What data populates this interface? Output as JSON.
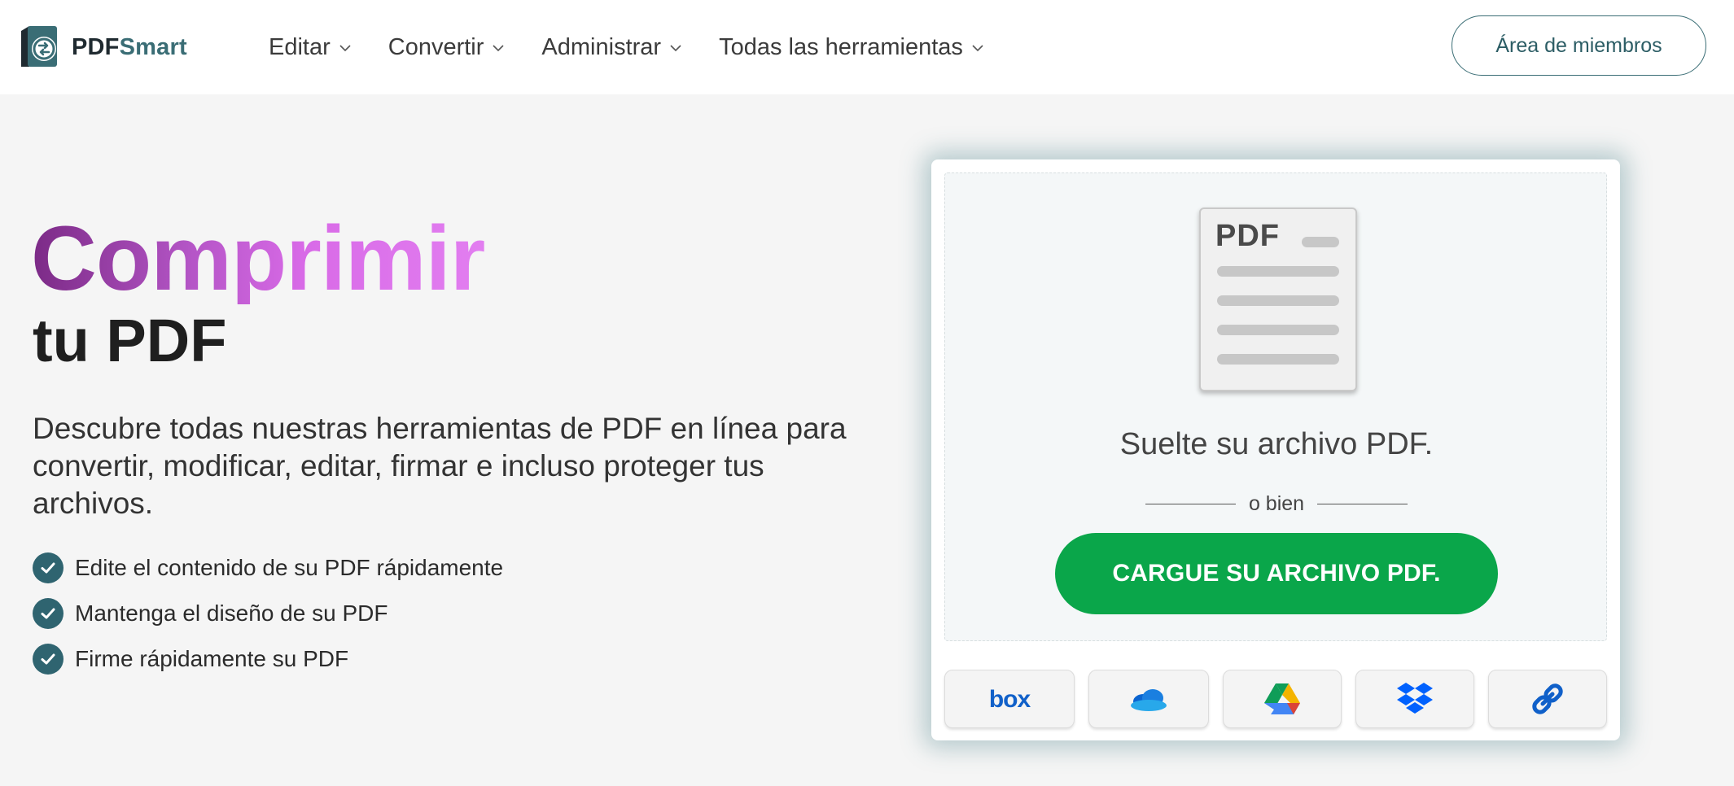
{
  "brand": {
    "part1": "PDF",
    "part2": "Smart",
    "logo_icon": "pdfsmart-logo-icon"
  },
  "nav": {
    "items": [
      {
        "label": "Editar",
        "icon": "chevron-down-icon"
      },
      {
        "label": "Convertir",
        "icon": "chevron-down-icon"
      },
      {
        "label": "Administrar",
        "icon": "chevron-down-icon"
      },
      {
        "label": "Todas las herramientas",
        "icon": "chevron-down-icon"
      }
    ],
    "member_button": "Área de miembros"
  },
  "hero": {
    "title": "Comprimir",
    "subtitle": "tu PDF",
    "description": "Descubre todas nuestras herramientas de PDF en línea para convertir, modificar, editar, firmar e incluso proteger tus archivos.",
    "features": [
      "Edite el contenido de su PDF rápidamente",
      "Mantenga el diseño de su PDF",
      "Firme rápidamente su PDF"
    ]
  },
  "upload": {
    "doc_label": "PDF",
    "drop_text": "Suelte su archivo PDF.",
    "or_text": "o bien",
    "button_label": "CARGUE SU ARCHIVO PDF.",
    "sources": [
      {
        "name": "box",
        "icon": "box-icon"
      },
      {
        "name": "OneDrive",
        "icon": "onedrive-icon"
      },
      {
        "name": "Google Drive",
        "icon": "google-drive-icon"
      },
      {
        "name": "Dropbox",
        "icon": "dropbox-icon"
      },
      {
        "name": "URL",
        "icon": "link-icon"
      }
    ]
  },
  "colors": {
    "accent": "#3a6d75",
    "button_green": "#0aa64a",
    "title_gradient_start": "#7b2a86",
    "title_gradient_end": "#e27ef0",
    "check_bg": "#2f6470"
  }
}
